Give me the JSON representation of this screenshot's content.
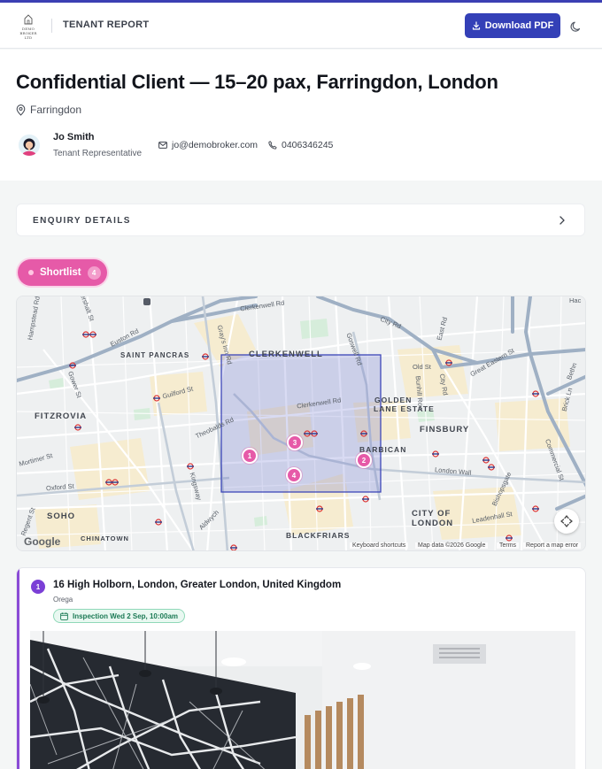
{
  "header": {
    "logo_text_line1": "DEMO",
    "logo_text_line2": "BROKER LTD",
    "title": "TENANT REPORT",
    "download_label": "Download PDF",
    "accent_color": "#3440b7"
  },
  "hero": {
    "title": "Confidential Client — 15–20 pax, Farringdon, London",
    "location": "Farringdon",
    "agent": {
      "name": "Jo Smith",
      "role": "Tenant Representative",
      "email": "jo@demobroker.com",
      "phone": "0406346245"
    }
  },
  "enquiry": {
    "label": "ENQUIRY DETAILS"
  },
  "shortlist": {
    "label": "Shortlist",
    "count": "4",
    "color": "#e65aa8"
  },
  "map": {
    "area_labels": {
      "clerkenwell": "CLERKENWELL",
      "saint_pancras": "SAINT PANCRAS",
      "fitzrovia": "FITZROVIA",
      "golden_lane": "GOLDEN\nLANE ESTATE",
      "golden": "GOLDEN",
      "lane_estate": "LANE ESTATE",
      "finsbury": "FINSBURY",
      "barbican": "BARBICAN",
      "soho": "SOHO",
      "chinatown": "CHINATOWN",
      "blackfriars": "BLACKFRIARS",
      "city_of": "CITY OF",
      "london": "LONDON"
    },
    "streets": {
      "euston_rd": "Euston Rd",
      "grays_inn_rd": "Gray's Inn Rd",
      "guilford_st": "Guilford St",
      "theobalds_rd": "Theobalds Rd",
      "clerkenwell_rd": "Clerkenwell Rd",
      "clerkenwell_rd2": "Clerkenwell Rd",
      "goswell_rd": "Goswell Rd",
      "city_rd": "City Rd",
      "old_st": "Old St",
      "great_eastern_st": "Great Eastern St",
      "bunhill_row": "Bunhill Row",
      "city_rd2": "City Rd",
      "east_rd": "East Rd",
      "london_wall": "London Wall",
      "bishopsgate": "Bishopsgate",
      "leadenhall_st": "Leadenhall St",
      "commercial_st": "Commercial St",
      "brick_ln": "Brick Ln",
      "bethnal": "Bethn",
      "gower_st": "Gower St",
      "oxford_st": "Oxford St",
      "mortimer_st": "Mortimer St",
      "regent_st": "Regent St",
      "kingsway": "Kingsway",
      "aldwych": "Aldwych",
      "hampstead_rd": "Hampstead Rd",
      "eversholt_st": "Evershalt St",
      "hac": "Hac"
    },
    "markers": [
      "1",
      "2",
      "3",
      "4"
    ],
    "google_label": "Google",
    "attribution": {
      "shortcuts": "Keyboard shortcuts",
      "data": "Map data ©2026 Google",
      "terms": "Terms",
      "report": "Report a map error"
    }
  },
  "listings": [
    {
      "number": "1",
      "address": "16 High Holborn, London, Greater London, United Kingdom",
      "operator": "Orega",
      "inspection": "Inspection Wed 2 Sep, 10:00am",
      "accent_color": "#8a4bd6"
    }
  ]
}
